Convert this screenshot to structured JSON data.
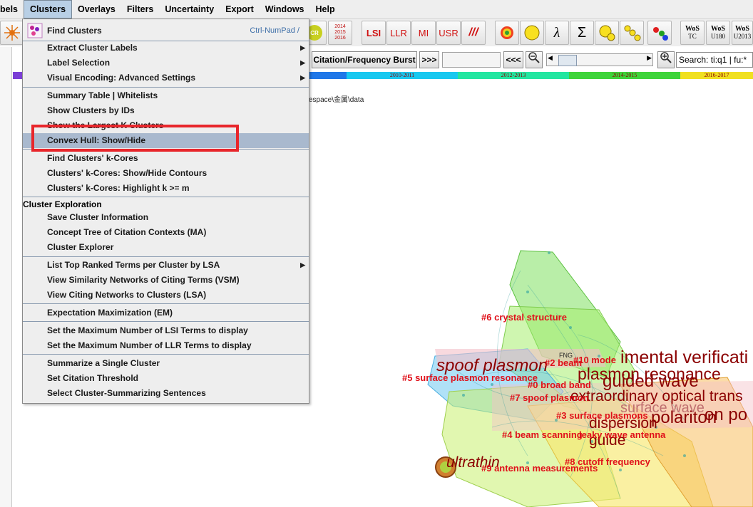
{
  "menubar": {
    "items": [
      "bels",
      "Clusters",
      "Overlays",
      "Filters",
      "Uncertainty",
      "Export",
      "Windows",
      "Help"
    ],
    "active": "Clusters"
  },
  "toolbar": {
    "years_button": [
      "2014",
      "2015",
      "2016"
    ],
    "cr_label": "CR",
    "text_buttons": [
      "LSI",
      "LLR",
      "MI",
      "USR",
      "///"
    ],
    "lambda": "λ",
    "sigma": "Σ",
    "wos_buttons": [
      {
        "top": "WoS",
        "bottom": "TC"
      },
      {
        "top": "WoS",
        "bottom": "U180"
      },
      {
        "top": "WoS",
        "bottom": "U2013"
      }
    ]
  },
  "row2": {
    "burst_button": "Citation/Frequency Burst",
    "next": ">>>",
    "prev": "<<<",
    "search_value": "Search: ti:q1 | fu:*"
  },
  "timeline": {
    "segments": [
      {
        "label": "",
        "color": "#7b3fd6"
      },
      {
        "label": "",
        "color": "#1f77e8"
      },
      {
        "label": "2010-2011",
        "color": "#18c8f0"
      },
      {
        "label": "2012-2013",
        "color": "#22e6a0"
      },
      {
        "label": "2014-2015",
        "color": "#3ed43a"
      },
      {
        "label": "2016-2017",
        "color": "#f0e020"
      }
    ]
  },
  "path_text": "espace\\金属\\data",
  "menu": {
    "find_clusters": "Find Clusters",
    "find_clusters_accel": "Ctrl-NumPad /",
    "items": [
      {
        "label": "Extract Cluster Labels",
        "submenu": true
      },
      {
        "label": "Label Selection",
        "submenu": true
      },
      {
        "label": "Visual Encoding: Advanced Settings",
        "submenu": true
      },
      {
        "label": "Summary Table | Whitelists",
        "submenu": false
      },
      {
        "label": "Show Clusters by IDs",
        "submenu": false
      },
      {
        "label": "Show the Largest K Clusters",
        "submenu": false
      },
      {
        "label": "Convex Hull: Show/Hide",
        "submenu": false,
        "highlighted": true
      },
      {
        "label": "Find Clusters' k-Cores",
        "submenu": false
      },
      {
        "label": "Clusters' k-Cores: Show/Hide Contours",
        "submenu": false
      },
      {
        "label": "Clusters' k-Cores: Highlight k >= m",
        "submenu": false
      },
      {
        "label": "Save Cluster Information",
        "submenu": false
      },
      {
        "label": "Concept Tree of Citation Contexts (MA)",
        "submenu": false
      },
      {
        "label": "Cluster Explorer",
        "submenu": false
      },
      {
        "label": "List Top Ranked Terms per Cluster by LSA",
        "submenu": true
      },
      {
        "label": "View Similarity Networks of Citing Terms (VSM)",
        "submenu": false
      },
      {
        "label": "View Citing Networks to Clusters (LSA)",
        "submenu": false
      },
      {
        "label": "Expectation Maximization (EM)",
        "submenu": false
      },
      {
        "label": "Set the Maximum Number of LSI Terms to display",
        "submenu": false
      },
      {
        "label": "Set the Maximum Number of LLR Terms to display",
        "submenu": false
      },
      {
        "label": "Summarize a Single Cluster",
        "submenu": false
      },
      {
        "label": "Set Citation Threshold",
        "submenu": false
      },
      {
        "label": "Select Cluster-Summarizing Sentences",
        "submenu": false
      }
    ],
    "section_header": "Cluster Exploration"
  },
  "visualization": {
    "cluster_labels": [
      "#6 crystal structure",
      "#2 beam",
      "#10 mode",
      "#5 surface plasmon resonance",
      "#0 broad band",
      "#7 spoof plasmon",
      "#3 surface plasmons",
      "#4 beam scanning",
      "leaky wave antenna",
      "#8 cutoff frequency",
      "#9 antenna measurements"
    ],
    "terms": [
      "imental verificati",
      "spoof plasmon",
      "plasmon resonance",
      "guided wave",
      "extraordinary optical trans",
      "polariton",
      "dispersion",
      "guide",
      "ultrathin",
      "surface wave",
      "on po",
      "FNG"
    ]
  },
  "icons": {
    "sun": "sun-icon",
    "find_clusters": "clusters-icon",
    "zoom_out": "zoom-out-icon",
    "zoom_in": "zoom-in-icon"
  }
}
